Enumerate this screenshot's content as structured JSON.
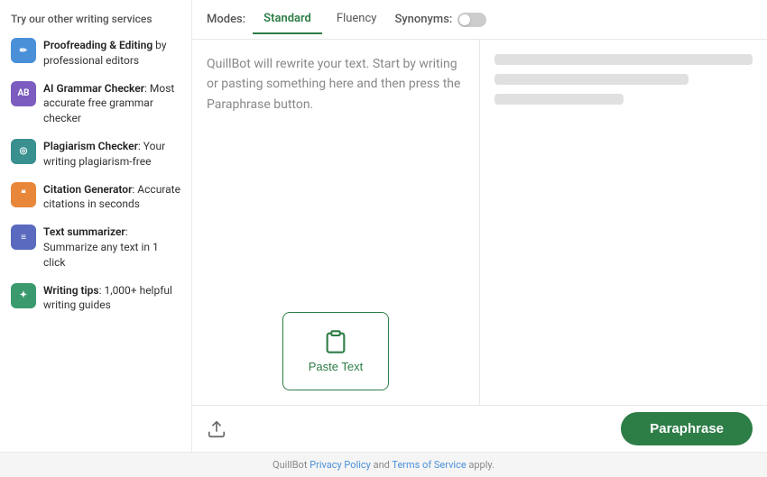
{
  "sidebar": {
    "title": "Try our other writing services",
    "items": [
      {
        "id": "proofreading",
        "label": "Proofreading & Editing",
        "suffix": " by professional editors",
        "iconColor": "icon-blue",
        "iconSymbol": "✏"
      },
      {
        "id": "grammar",
        "label": "AI Grammar Checker",
        "suffix": ": Most accurate free grammar checker",
        "iconColor": "icon-purple",
        "iconSymbol": "AB"
      },
      {
        "id": "plagiarism",
        "label": "Plagiarism Checker",
        "suffix": ": Your writing plagiarism-free",
        "iconColor": "icon-teal",
        "iconSymbol": "◎"
      },
      {
        "id": "citation",
        "label": "Citation Generator",
        "suffix": ": Accurate citations in seconds",
        "iconColor": "icon-orange",
        "iconSymbol": "❝"
      },
      {
        "id": "summarizer",
        "label": "Text summarizer",
        "suffix": ": Summarize any text in 1 click",
        "iconColor": "icon-indigo",
        "iconSymbol": "≡"
      },
      {
        "id": "tips",
        "label": "Writing tips",
        "suffix": ": 1,000+ helpful writing guides",
        "iconColor": "icon-green",
        "iconSymbol": "✦"
      }
    ]
  },
  "tabs": {
    "label": "Modes:",
    "items": [
      {
        "id": "standard",
        "label": "Standard",
        "active": true
      },
      {
        "id": "fluency",
        "label": "Fluency",
        "active": false
      }
    ],
    "synonyms": {
      "label": "Synonyms:",
      "enabled": false
    }
  },
  "editor": {
    "placeholder": "QuillBot will rewrite your text. Start by writing or pasting something here and then press the Paraphrase button.",
    "paste_button_label": "Paste Text"
  },
  "toolbar": {
    "paraphrase_label": "Paraphrase"
  },
  "footer": {
    "text_before": "QuillBot ",
    "privacy_label": "Privacy Policy",
    "text_middle": " and ",
    "terms_label": "Terms of Service",
    "text_after": " apply."
  }
}
